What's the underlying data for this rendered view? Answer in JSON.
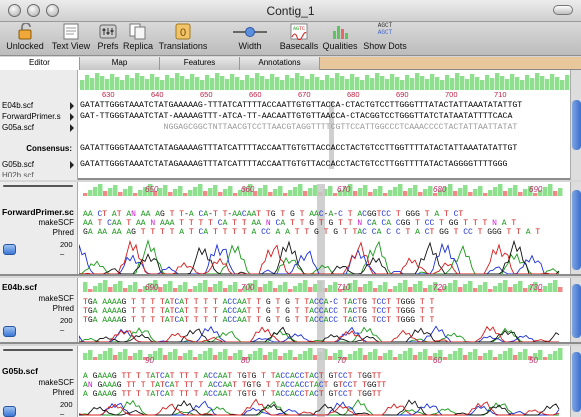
{
  "window": {
    "title": "Contig_1"
  },
  "toolbar": {
    "items": [
      {
        "label": "Unlocked",
        "icon": "lock-icon"
      },
      {
        "label": "Text View",
        "icon": "text-view-icon"
      },
      {
        "label": "Prefs",
        "icon": "prefs-icon"
      },
      {
        "label": "Replica",
        "icon": "replica-icon"
      },
      {
        "label": "Translations",
        "icon": "translations-icon"
      },
      {
        "label": "Width",
        "icon": "width-slider-icon"
      },
      {
        "label": "Basecalls",
        "icon": "basecalls-icon"
      },
      {
        "label": "Qualities",
        "icon": "qualities-icon"
      },
      {
        "label": "Show Dots",
        "icon": "show-dots-icon"
      }
    ],
    "show_dots_glyph_top": "AGCT",
    "show_dots_glyph_bottom": "AGCT"
  },
  "tabs": [
    "Editor",
    "Map",
    "Features",
    "Annotations"
  ],
  "editor": {
    "ruler": [
      "630",
      "640",
      "650",
      "660",
      "670",
      "680",
      "690",
      "700",
      "710"
    ],
    "rows": [
      {
        "label": "E04b.scf",
        "seq": "GATATTGGGTAAATCTATGAAAAAG-TTTATCATTTTACCAATTGTGTTACCA-CTACTGTCCTTGGGTTTATACTATTAAATATATTGT"
      },
      {
        "label": "ForwardPrimer.s",
        "seq": "GAT-TTGGGTAAATCTAT-AAAAAGTTT-ATCA-TT-AACAATTGTGTTAACCA-CTACGGTCCTGGGTTATCTATAATATTTTCACA"
      },
      {
        "label": "G05a.scf",
        "seq": "                 NGGAGCGGCTNTTAACGTCCTTAACGTAGGTTTTCGTTCCATTGGCCCTCAAACCCCTACTATTAATTATAT"
      },
      {
        "label": "Consensus:",
        "seq": "GATATTGGGTAAATCTATAGAAAAGTTTATCATTTTACCAATTGTGTTACCACCTACTGTCCTTGGTTTTATACTATTAAATATATTGT"
      },
      {
        "label": "G05b.scf",
        "seq": "GATATTGGGTAAATCTATAGAAAAGTTTATCATTTTACCAATTGTGTTACCACCTACTGTCCTTGGTTTTATACTAGGGGTTTTGGG"
      }
    ],
    "partial_row_label": "H02b.scf"
  },
  "panels": [
    {
      "name": "ForwardPrimer.sc",
      "sub1": "makeSCF",
      "sub2": "Phred",
      "tick": "200",
      "positions": [
        "650",
        "660",
        "670",
        "680",
        "690",
        "700"
      ],
      "line1": "AA CT AT AN AA AG T T-A CA-T T-AACAAT TG T G T AAC-A-C T ACGGTCC T GGG T A T CT",
      "line2": "AA T CAA T AA N AAA T T T T CA T T AA N CA T T G T G T T N CA CA CGG T CC T GG T T T N A T",
      "line3": "GA AA AA AG T T T T A T CA T T T T A CC A A T T G T G T TAC CA C C T A CT GG T CC T GGG T T A T"
    },
    {
      "name": "E04b.scf",
      "sub1": "makeSCF",
      "sub2": "Phred",
      "tick": "200",
      "positions": [
        "690",
        "700",
        "710",
        "720",
        "730"
      ],
      "line1": "TGA AAAAG T T T TATCAT T T T ACCAAT T G T G T TACCA-C TACTG TCCT TGGG T T",
      "line2": "TGA AAAAG T T T TATCAT T T T ACCAAT T G T G T TACCACC TACTG TCCT TGGG T T",
      "line3": "TGA AAAAG T T T TATCAT T T T ACCAAT T G T G T TACCACC TACTG TCCT TGGG T T"
    },
    {
      "name": "G05b.scf",
      "sub1": "makeSCF",
      "sub2": "Phred",
      "tick": "200",
      "positions": [
        "90",
        "80",
        "70",
        "60",
        "50"
      ],
      "line1": "A GAAAG TT T TATCAT TT T ACCAAT TGTG T TACCACCTACT GTCCT TGGTT",
      "line2": "AN GAAAG TT T TATCAT TT T ACCAAT TGTG T TACCACCTACT GTCCT TGGTT",
      "line3": "A GAAAG TT T TATCAT TT T ACCAAT TGTG T TACCACCTACT GTCCT TGGTT"
    }
  ],
  "colors": {
    "A": "#1a9a1a",
    "C": "#1b2fd6",
    "G": "#111111",
    "T": "#d41c1c",
    "N": "#d61cd6",
    "quality": "#8ee08e",
    "quality_low": "#f08a8a",
    "highlight": "#c8c8c8"
  }
}
